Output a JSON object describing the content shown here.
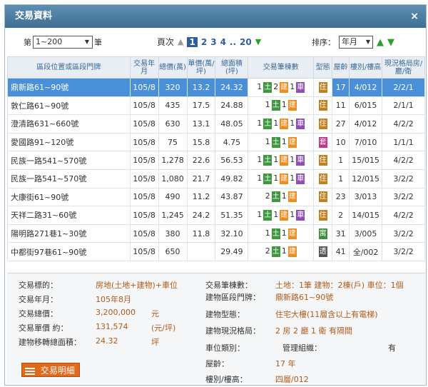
{
  "title": "交易資料",
  "close": "×",
  "toolbar": {
    "range_prefix": "第",
    "range_value": "1~200",
    "range_suffix": "筆",
    "page_label": "頁次",
    "pages": [
      "1",
      "2",
      "3",
      "4",
      "..",
      "20"
    ],
    "sort_label": "排序：",
    "sort_value": "年月"
  },
  "table": {
    "headers": [
      "區段位置或區段門牌",
      "交易年月",
      "總價(萬)",
      "單價(萬/坪)",
      "總面積(坪)",
      "交易筆棟數",
      "型態",
      "屋齡",
      "樓別/樓高",
      "現況格局房/廳/衛"
    ],
    "rows": [
      {
        "addr": "鼎新路61~90號",
        "ym": "105/8",
        "total": "320",
        "unit": "13.2",
        "area": "24.32",
        "counts": [
          "1",
          "2",
          "1"
        ],
        "type": "住",
        "age": "17",
        "floor": "4/012",
        "layout": "2/2/1",
        "selected": true
      },
      {
        "addr": "敦仁路61~90號",
        "ym": "105/8",
        "total": "435",
        "unit": "17.5",
        "area": "24.88",
        "counts": [
          "1",
          "1"
        ],
        "type": "住",
        "age": "11",
        "floor": "6/015",
        "layout": "2/1/1"
      },
      {
        "addr": "澄清路631~660號",
        "ym": "105/8",
        "total": "630",
        "unit": "13.1",
        "area": "48.05",
        "counts": [
          "1",
          "1",
          "1"
        ],
        "type": "住",
        "age": "27",
        "floor": "4/012",
        "layout": "4/2/2"
      },
      {
        "addr": "愛國路91~120號",
        "ym": "105/8",
        "total": "75",
        "unit": "15.8",
        "area": "4.75",
        "counts": [
          "1",
          "1"
        ],
        "type": "套",
        "age": "10",
        "floor": "7/010",
        "layout": "1/1/1"
      },
      {
        "addr": "民族一路541~570號",
        "ym": "105/8",
        "total": "1,278",
        "unit": "22.6",
        "area": "56.53",
        "counts": [
          "1",
          "1",
          "1"
        ],
        "type": "住",
        "age": "1",
        "floor": "15/015",
        "layout": "4/2/2"
      },
      {
        "addr": "民族一路541~570號",
        "ym": "105/8",
        "total": "1,080",
        "unit": "21.7",
        "area": "49.82",
        "counts": [
          "1",
          "1",
          "1"
        ],
        "type": "住",
        "age": "1",
        "floor": "12/015",
        "layout": "3/2/2"
      },
      {
        "addr": "大康街61~90號",
        "ym": "105/8",
        "total": "490",
        "unit": "11.2",
        "area": "43.87",
        "counts": [
          "2",
          "1"
        ],
        "type": "住",
        "age": "23",
        "floor": "3/013",
        "layout": "3/2/2"
      },
      {
        "addr": "天祥二路31~60號",
        "ym": "105/8",
        "total": "1,245",
        "unit": "24.2",
        "area": "51.35",
        "counts": [
          "1",
          "1",
          "1"
        ],
        "type": "住",
        "age": "2",
        "floor": "14/015",
        "layout": "4/2/2"
      },
      {
        "addr": "陽明路271巷1~30號",
        "ym": "105/8",
        "total": "380",
        "unit": "11.8",
        "area": "32.10",
        "counts": [
          "1",
          "1"
        ],
        "type": "寓",
        "age": "31",
        "floor": "3/005",
        "layout": "3/2/2"
      },
      {
        "addr": "中都街97巷61~90號",
        "ym": "105/8",
        "total": "650",
        "unit": "",
        "area": "29.49",
        "counts": [
          "2",
          "1"
        ],
        "type": "透",
        "age": "41",
        "floor": "全/002",
        "layout": "3/2/2"
      }
    ]
  },
  "detail": {
    "left": [
      {
        "label": "交易標的：",
        "value": "房地(土地+建物)+車位",
        "unit": ""
      },
      {
        "label": "交易年月：",
        "value": "105年8月",
        "unit": ""
      },
      {
        "label": "交易總價：",
        "value": "3,200,000",
        "unit": "元"
      },
      {
        "label": "交易單價 約：",
        "value": "131,574",
        "unit": "(元/坪)"
      },
      {
        "label": "建物移轉總面積：",
        "value": "24.32",
        "unit": "坪"
      }
    ],
    "right": [
      {
        "label": "交易筆棟數：",
        "value": "土地：1筆 建物：2棟(戶) 車位：1個"
      },
      {
        "label": "建物區段門牌：",
        "value": "鼎新路61~90號"
      },
      {
        "label": "建物型態：",
        "value": "住宅大樓(11層含以上有電梯)"
      },
      {
        "label": "建物現況格局：",
        "value": "2 房 2 廳 1 衛 有隔間"
      },
      {
        "label": "車位類別：",
        "value": "管理組織：",
        "extra": "有"
      },
      {
        "label": "屋齡：",
        "value": "17 年"
      },
      {
        "label": "樓別/樓高：",
        "value": "四層/012"
      }
    ],
    "button_label": "交易明細"
  },
  "badge_labels": {
    "land": "土",
    "build": "建",
    "car": "車"
  }
}
